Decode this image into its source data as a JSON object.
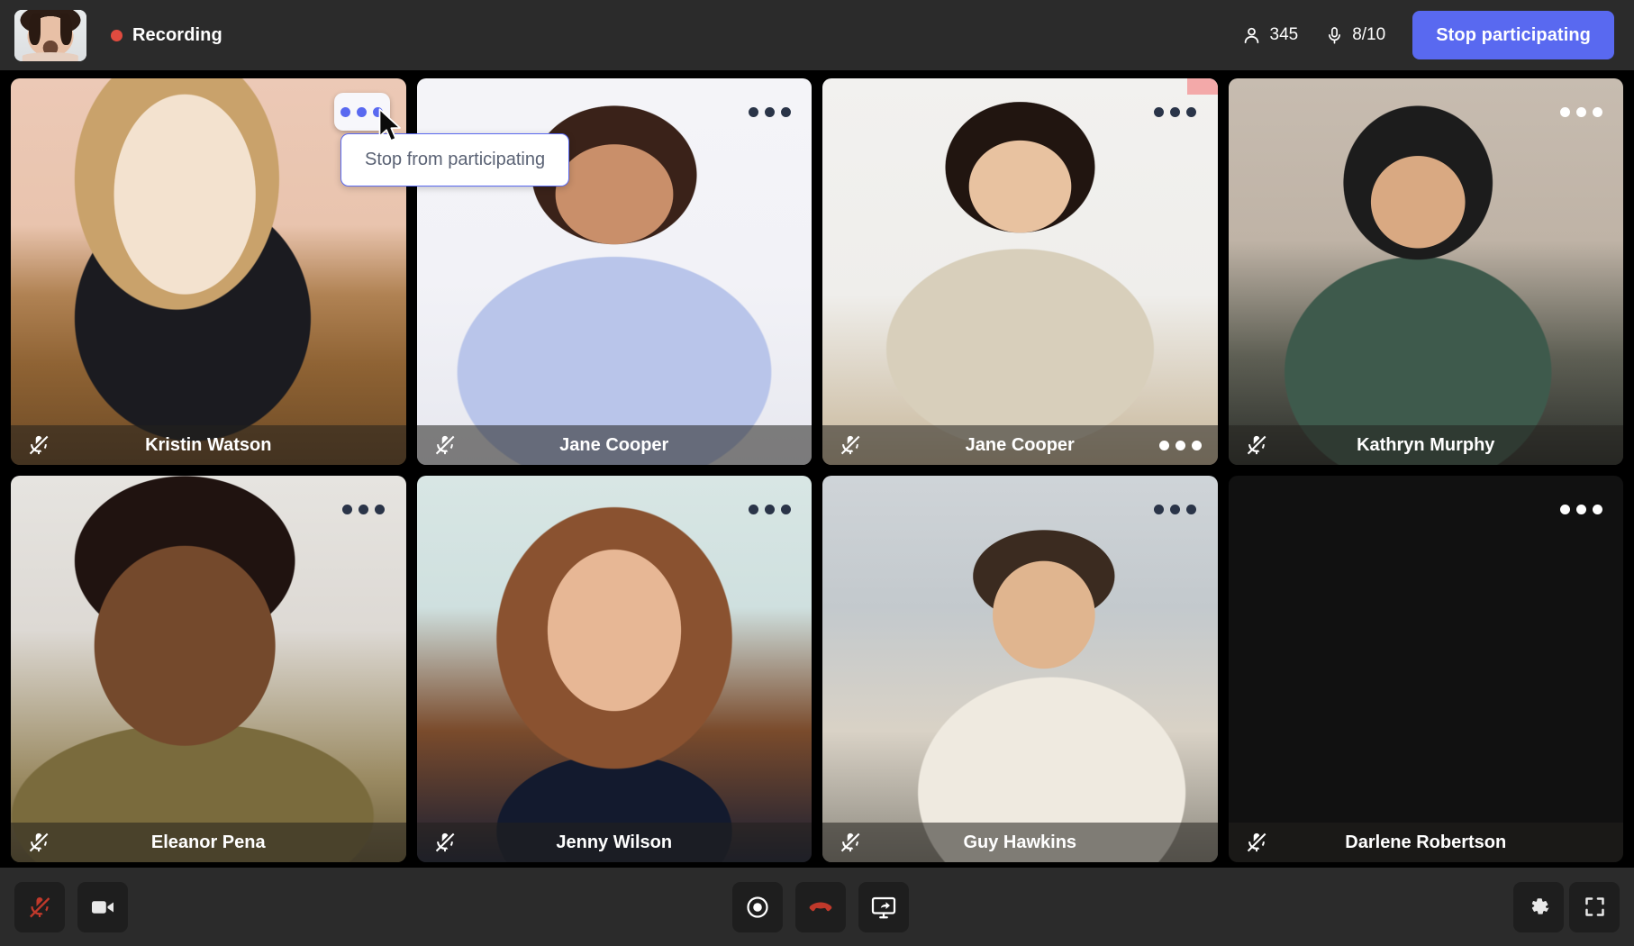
{
  "topbar": {
    "avatar_name": "self-avatar",
    "recording_label": "Recording",
    "recording_dot_color": "#e04b3f",
    "participants_count": "345",
    "participants_icon": "person-icon",
    "mic_count": "8/10",
    "mic_icon": "microphone-icon",
    "stop_button_label": "Stop participating",
    "accent_color": "#5969f0"
  },
  "tooltip": {
    "label": "Stop from participating",
    "border_color": "#5969f0"
  },
  "grid": {
    "tiles": [
      {
        "name": "Kristin Watson",
        "muted": true,
        "menu_style": "active",
        "menu_in_namebar": false,
        "corner_accent": false
      },
      {
        "name": "Jane Cooper",
        "muted": true,
        "menu_style": "dark",
        "menu_in_namebar": false,
        "corner_accent": false
      },
      {
        "name": "Jane Cooper",
        "muted": true,
        "menu_style": "dark",
        "menu_in_namebar": true,
        "corner_accent": true
      },
      {
        "name": "Kathryn Murphy",
        "muted": true,
        "menu_style": "light",
        "menu_in_namebar": false,
        "corner_accent": false
      },
      {
        "name": "Eleanor Pena",
        "muted": true,
        "menu_style": "dark",
        "menu_in_namebar": false,
        "corner_accent": false
      },
      {
        "name": "Jenny Wilson",
        "muted": true,
        "menu_style": "dark",
        "menu_in_namebar": false,
        "corner_accent": false
      },
      {
        "name": "Guy Hawkins",
        "muted": true,
        "menu_style": "dark",
        "menu_in_namebar": false,
        "corner_accent": false
      },
      {
        "name": "Darlene Robertson",
        "muted": true,
        "menu_style": "light",
        "menu_in_namebar": false,
        "corner_accent": false
      }
    ]
  },
  "bottombar": {
    "left": [
      {
        "icon": "microphone-muted-icon",
        "label": "Unmute microphone",
        "state": "muted"
      },
      {
        "icon": "camera-icon",
        "label": "Toggle camera",
        "state": "on"
      }
    ],
    "center": [
      {
        "icon": "record-icon",
        "label": "Record"
      },
      {
        "icon": "hangup-icon",
        "label": "Leave call"
      },
      {
        "icon": "screen-share-icon",
        "label": "Share screen"
      }
    ],
    "right": [
      {
        "icon": "gear-icon",
        "label": "Settings"
      },
      {
        "icon": "fullscreen-icon",
        "label": "Fullscreen"
      }
    ]
  }
}
